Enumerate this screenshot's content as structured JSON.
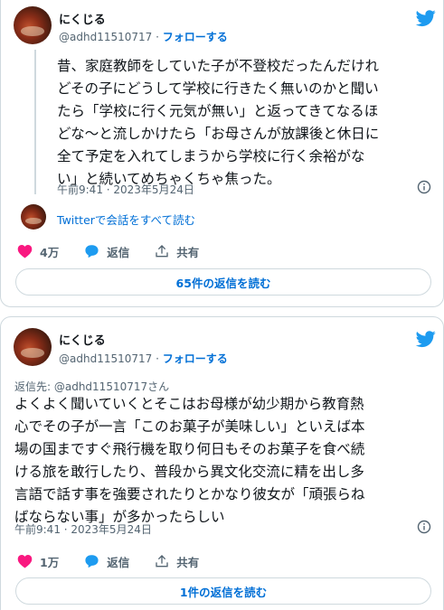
{
  "tweet1": {
    "name": "にくじる",
    "handle": "@adhd11510717",
    "separator": " · ",
    "follow": "フォローする",
    "text_lines": [
      "昔、家庭教師をしていた子が不登校だったんだけれ",
      "どその子にどうして学校に行きたく無いのかと聞い",
      "たら「学校に行く元気が無い」と返ってきてなるほ",
      "どな〜と流しかけたら「お母さんが放課後と休日に",
      "全て予定を入れてしまうから学校に行く余裕がな",
      "い」と続いてめちゃくちゃ焦った。"
    ],
    "timestamp": "午前9:41 · 2023年5月24日",
    "conversation_link": "Twitterで会話をすべて読む",
    "likes": "4万",
    "reply_label": "返信",
    "share_label": "共有",
    "replies_button": "65件の返信を読む"
  },
  "tweet2": {
    "name": "にくじる",
    "handle": "@adhd11510717",
    "separator": " · ",
    "follow": "フォローする",
    "reply_to": "返信先: @adhd11510717さん",
    "text_lines": [
      "よくよく聞いていくとそこはお母様が幼少期から教育熱",
      "心でその子が一言「このお菓子が美味しい」といえば本",
      "場の国まですぐ飛行機を取り何日もそのお菓子を食べ続",
      "ける旅を敢行したり、普段から異文化交流に精を出し多",
      "言語で話す事を強要されたりとかなり彼女が「頑張らね",
      "ばならない事」が多かったらしい"
    ],
    "timestamp": "午前9:41 · 2023年5月24日",
    "likes": "1万",
    "reply_label": "返信",
    "share_label": "共有",
    "replies_button": "1件の返信を読む"
  },
  "colors": {
    "accent": "#006fd6",
    "twitter_blue": "#1d9bf0",
    "like_red": "#f91880",
    "muted": "#536471",
    "border": "#cfd9de"
  },
  "icons": [
    "twitter-bird-icon",
    "info-icon",
    "heart-icon",
    "reply-bubble-icon",
    "share-icon"
  ]
}
